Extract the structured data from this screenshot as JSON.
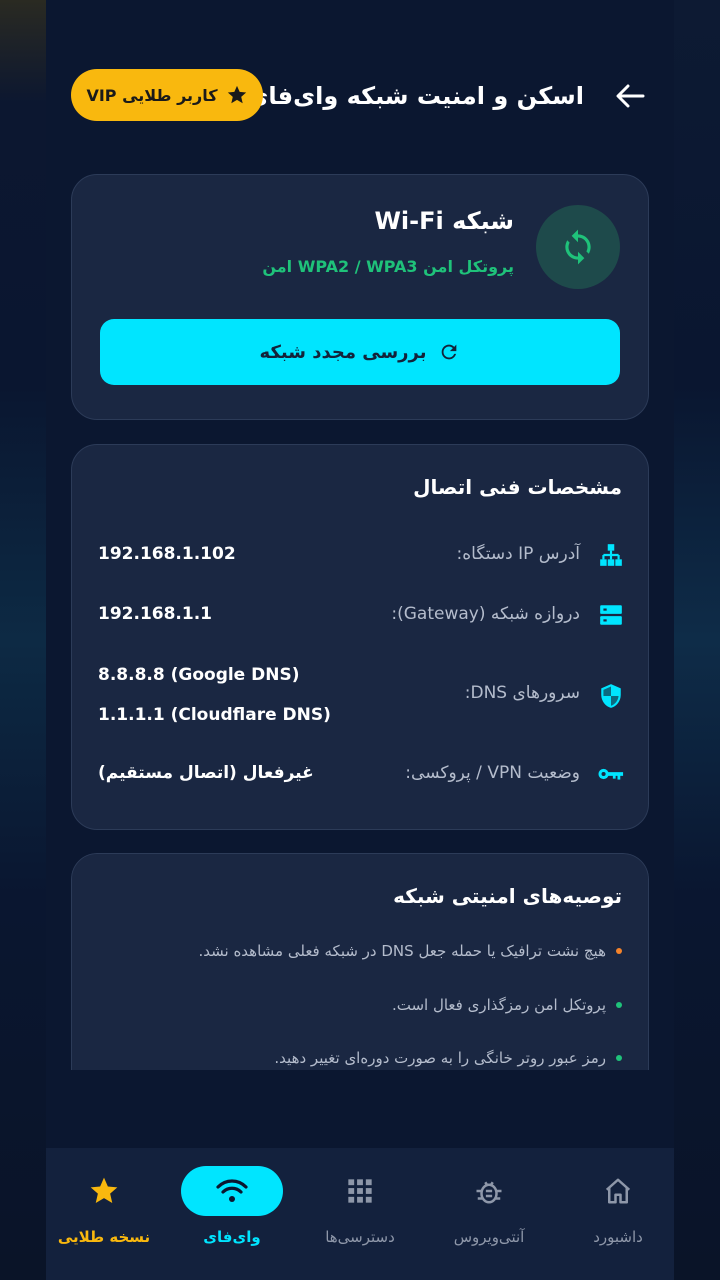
{
  "header": {
    "title": "اسکن و امنیت شبکه وای‌فای",
    "vip_label": "کاربر طلایی VIP"
  },
  "network": {
    "name": "شبکه Wi-Fi",
    "protocol": "پروتکل امن WPA2 / WPA3 امن",
    "recheck_label": "بررسی مجدد شبکه"
  },
  "specs": {
    "title": "مشخصات فنی اتصال",
    "rows": [
      {
        "label": "آدرس IP دستگاه:",
        "value": "192.168.1.102",
        "icon": "network-tree-icon"
      },
      {
        "label": "دروازه شبکه (Gateway):",
        "value": "192.168.1.1",
        "icon": "server-icon"
      },
      {
        "label": "سرورهای DNS:",
        "value": "8.8.8.8 (Google DNS)",
        "value2": "1.1.1.1 (Cloudflare DNS)",
        "icon": "shield-icon"
      },
      {
        "label": "وضعیت VPN / پروکسی:",
        "value": "غیرفعال (اتصال مستقیم)",
        "icon": "key-icon"
      }
    ]
  },
  "tips": {
    "title": "توصیه‌های امنیتی شبکه",
    "items": [
      {
        "text": "هیچ نشت ترافیک یا حمله جعل DNS در شبکه فعلی مشاهده نشد.",
        "color": "#f5832a"
      },
      {
        "text": "پروتکل امن رمزگذاری فعال است.",
        "color": "#1fc27a"
      },
      {
        "text": "رمز عبور روتر خانگی را به صورت دوره‌ای تغییر دهید.",
        "color": "#1fc27a"
      }
    ]
  },
  "nav": {
    "items": [
      {
        "label": "داشبورد",
        "icon": "home-icon"
      },
      {
        "label": "آنتی‌ویروس",
        "icon": "bug-icon"
      },
      {
        "label": "دسترسی‌ها",
        "icon": "grid-icon"
      },
      {
        "label": "وای‌فای",
        "icon": "wifi-icon",
        "active": true
      },
      {
        "label": "نسخه طلایی",
        "icon": "star-icon"
      }
    ]
  },
  "colors": {
    "accent": "#00e5ff",
    "gold": "#f9b80e",
    "safe": "#1fc27a",
    "warning": "#f5832a"
  }
}
